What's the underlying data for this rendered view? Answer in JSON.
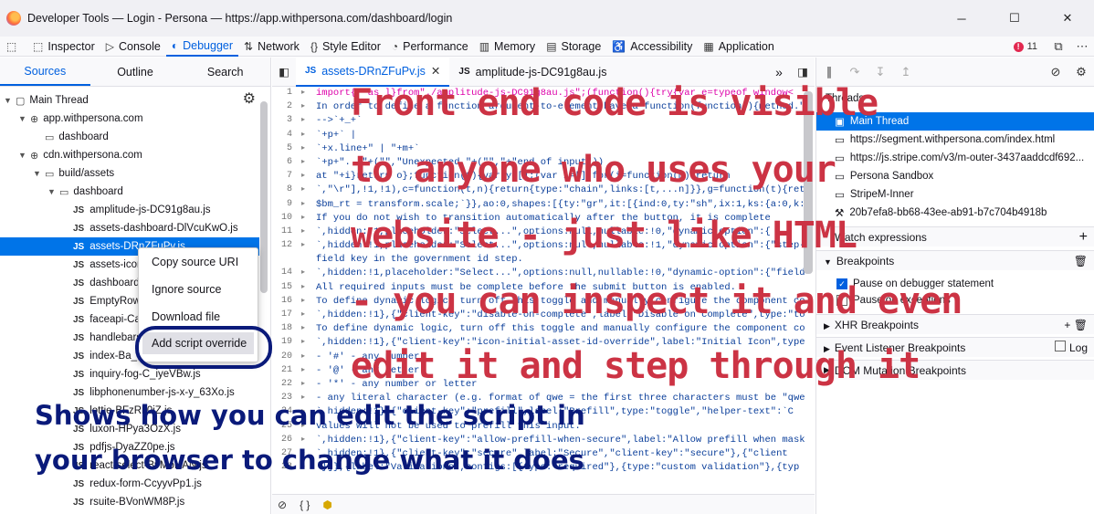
{
  "window": {
    "title": "Developer Tools — Login - Persona — https://app.withpersona.com/dashboard/login",
    "min": "─",
    "max": "☐",
    "close": "✕"
  },
  "toolbar": {
    "items": [
      {
        "label": "Inspector",
        "icon": "inspector-icon"
      },
      {
        "label": "Console",
        "icon": "console-icon"
      },
      {
        "label": "Debugger",
        "icon": "debugger-icon",
        "active": true
      },
      {
        "label": "Network",
        "icon": "network-icon"
      },
      {
        "label": "Style Editor",
        "icon": "style-editor-icon"
      },
      {
        "label": "Performance",
        "icon": "performance-icon"
      },
      {
        "label": "Memory",
        "icon": "memory-icon"
      },
      {
        "label": "Storage",
        "icon": "storage-icon"
      },
      {
        "label": "Accessibility",
        "icon": "accessibility-icon"
      },
      {
        "label": "Application",
        "icon": "application-icon"
      }
    ],
    "error_count": "11"
  },
  "left": {
    "tabs": [
      "Sources",
      "Outline",
      "Search"
    ],
    "tree": [
      {
        "label": "Main Thread",
        "depth": 0,
        "tw": "▼",
        "ic": "▢"
      },
      {
        "label": "app.withpersona.com",
        "depth": 1,
        "tw": "▼",
        "ic": "⊕"
      },
      {
        "label": "dashboard",
        "depth": 2,
        "tw": "",
        "ic": "▭"
      },
      {
        "label": "cdn.withpersona.com",
        "depth": 1,
        "tw": "▼",
        "ic": "⊕"
      },
      {
        "label": "build/assets",
        "depth": 2,
        "tw": "▼",
        "ic": "▭"
      },
      {
        "label": "dashboard",
        "depth": 3,
        "tw": "▼",
        "ic": "▭"
      },
      {
        "label": "amplitude-js-DC91g8au.js",
        "depth": 4,
        "js": true
      },
      {
        "label": "assets-dashboard-DlVcuKwO.js",
        "depth": 4,
        "js": true
      },
      {
        "label": "assets-DRnZFuPv.js",
        "depth": 4,
        "js": true,
        "sel": true
      },
      {
        "label": "assets-icons-",
        "depth": 4,
        "js": true
      },
      {
        "label": "dashboard-D",
        "depth": 4,
        "js": true
      },
      {
        "label": "EmptyRow-D",
        "depth": 4,
        "js": true
      },
      {
        "label": "faceapi-Ca3o",
        "depth": 4,
        "js": true
      },
      {
        "label": "handlebars-B",
        "depth": 4,
        "js": true
      },
      {
        "label": "index-Ba_8-n",
        "depth": 4,
        "js": true
      },
      {
        "label": "inquiry-fog-C_iyeVBw.js",
        "depth": 4,
        "js": true
      },
      {
        "label": "libphonenumber-js-x-y_63Xo.js",
        "depth": 4,
        "js": true
      },
      {
        "label": "lottie-BFzRk0iZ.js",
        "depth": 4,
        "js": true
      },
      {
        "label": "luxon-HPya3OzX.js",
        "depth": 4,
        "js": true
      },
      {
        "label": "pdfjs-DyaZZ0pe.js",
        "depth": 4,
        "js": true
      },
      {
        "label": "react-select-BvMoNAN.js",
        "depth": 4,
        "js": true
      },
      {
        "label": "redux-form-CcyyvPp1.js",
        "depth": 4,
        "js": true
      },
      {
        "label": "rsuite-BVonWM8P.js",
        "depth": 4,
        "js": true
      }
    ],
    "context_menu": [
      "Copy source URI",
      "Ignore source",
      "Download file",
      "Add script override"
    ]
  },
  "editor": {
    "tabs": [
      "assets-DRnZFuPv.js",
      "amplitude-js-DC91g8au.js"
    ],
    "lines": [
      {
        "n": "1",
        "t": "import{r as l}from\"./amplitude-js-DC91g8au.js\";(function(){try{var e=typeof window<"
      },
      {
        "n": "2",
        "t": "In order to define a function-argument-to-element-have a function(function(){method.\")"
      },
      {
        "n": "3",
        "t": " -->`+_+`"
      },
      {
        "n": "4",
        "t": "`+p+` |"
      },
      {
        "n": "5",
        "t": "`+x.line+\" | \"+m+`"
      },
      {
        "n": "6",
        "t": "`+p+\"...\"+(\"\",\"Unexpected \"+(\"\",\"+\"end of input\"))"
      },
      {
        "n": "7",
        "t": " at \"+i}return o};function(t){var y=[];(var i=[];for(i=function(m){return"
      },
      {
        "n": "8",
        "t": "`,\"\\r\"],!1,!1),c=function(t,n){return{type:\"chain\",links:[t,...n]}},g=function(t){ret"
      },
      {
        "n": "9",
        "t": "$bm_rt = transform.scale;`}},ao:0,shapes:[{ty:\"gr\",it:[{ind:0,ty:\"sh\",ix:1,ks:{a:0,k:"
      },
      {
        "n": "10",
        "t": "  If you do not wish to transition automatically after the button, it is complete"
      },
      {
        "n": "11",
        "t": "`,hidden:!1,placeholder:\"Select...\",options:null,nullable:!0,\"dynamic-option\":{"
      },
      {
        "n": "12",
        "t": "`,hidden:!1,placeholder:\"Select...\",options:null,nullable:!1,\"dynamic-option\":{\"step-"
      },
      {
        "n": "",
        "t": "field key in the government id step."
      },
      {
        "n": "14",
        "t": "`,hidden:!1,placeholder:\"Select...\",options:null,nullable:!0,\"dynamic-option\":{\"field"
      },
      {
        "n": "15",
        "t": "All required inputs must be complete before the submit button is enabled."
      },
      {
        "n": "16",
        "t": "To define dynamic logic, turn off this toggle and manually configure the component co"
      },
      {
        "n": "17",
        "t": "`,hidden:!1},{\"client-key\":\"disable-on-complete\",label:\"Disable on complete\",type:\"to"
      },
      {
        "n": "18",
        "t": "To define dynamic logic, turn off this toggle and manually configure the component co"
      },
      {
        "n": "19",
        "t": "`,hidden:!1},{\"client-key\":\"icon-initial-asset-id-override\",label:\"Initial Icon\",type"
      },
      {
        "n": "20",
        "t": "- '#' - any number"
      },
      {
        "n": "21",
        "t": "- '@' - any letter"
      },
      {
        "n": "22",
        "t": "- '*' - any number or letter"
      },
      {
        "n": "23",
        "t": "- any literal character (e.g. format of qwe = the first three characters must be \"qwe"
      },
      {
        "n": "24",
        "t": "`,hidden:!1},{\"client-key\":\"prefill\",label:\"Prefill\",type:\"toggle\",\"helper-text\":`C"
      },
      {
        "n": "25",
        "t": "values will not be used to prefill this input."
      },
      {
        "n": "26",
        "t": "`,hidden:!1},{\"client-key\":\"allow-prefill-when-secure\",label:\"Allow prefill when mask"
      },
      {
        "n": "27",
        "t": "`,hidden:!1},{\"client-key\":\"secure\",label:\"Secure\",\"client-key\":\"secure\"},{\"client"
      },
      {
        "n": "28",
        "t": "`}]},{label:\"Validations\",configs:[{type:\"required\"},{type:\"custom validation\"},{typ"
      }
    ],
    "status": [
      "{ }"
    ]
  },
  "right": {
    "threads_title": "Threads",
    "threads": [
      "Main Thread",
      "https://segment.withpersona.com/index.html",
      "https://js.stripe.com/v3/m-outer-3437aaddcdf692...",
      "Persona Sandbox",
      "StripeM-Inner",
      "20b7efa8-bb68-43ee-ab91-b7c704b4918b"
    ],
    "watch": "Watch expressions",
    "breakpoints": "Breakpoints",
    "pause_debugger": "Pause on debugger statement",
    "pause_exceptions": "Pause on exceptions",
    "xhr": "XHR Breakpoints",
    "event": "Event Listener Breakpoints",
    "log": "Log",
    "dom": "DOM Mutation Breakpoints"
  },
  "overlay": {
    "red": [
      "Front end code is visible",
      "to anyone who uses your",
      "website - just like HTML",
      "- you can inspect it and even",
      "edit it and step through it"
    ],
    "blue": [
      "Shows how you can edit the script in",
      "your browser to change what it does"
    ]
  }
}
